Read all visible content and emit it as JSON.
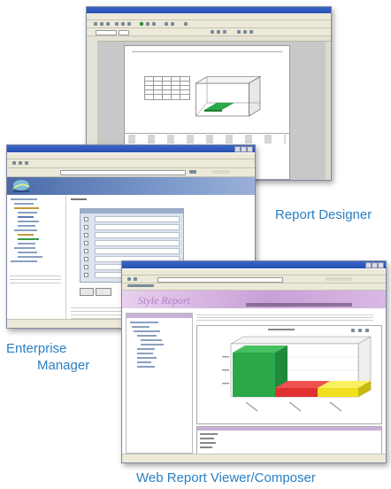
{
  "captions": {
    "report_designer": "Report Designer",
    "enterprise_manager_line1": "Enterprise",
    "enterprise_manager_line2": "Manager",
    "web_report_viewer": "Web Report Viewer/Composer"
  },
  "web_viewer": {
    "banner_title": "Style Report"
  },
  "colors": {
    "caption_blue": "#2a7fc3",
    "bar_green": "#2aa84a",
    "bar_red": "#e03030",
    "bar_yellow": "#f0e020",
    "em_banner": "#7896c8",
    "wv_banner": "#c8a0d8"
  }
}
